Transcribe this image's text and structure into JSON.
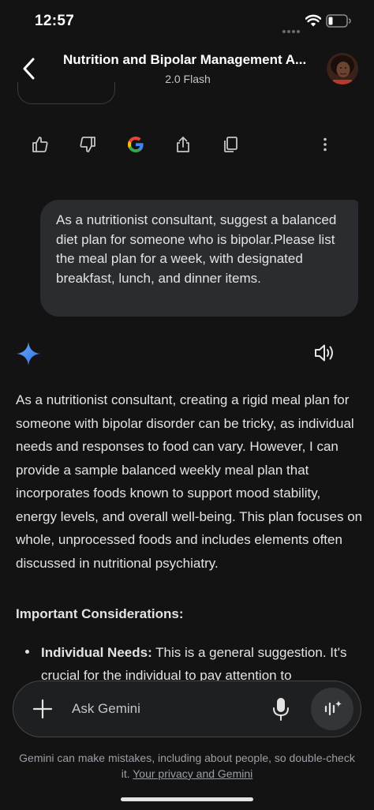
{
  "status_bar": {
    "time": "12:57"
  },
  "header": {
    "title": "Nutrition and Bipolar Management A...",
    "model": "2.0 Flash"
  },
  "user_message": {
    "text": "As a nutritionist consultant, suggest a balanced diet plan for someone who is bipolar.Please list the meal plan for a week, with designated breakfast, lunch, and dinner items."
  },
  "response": {
    "paragraph": "As a nutritionist consultant, creating a rigid meal plan for someone with bipolar disorder can be tricky, as individual needs and responses to food can vary. However, I can provide a sample balanced weekly meal plan that incorporates foods known to support mood stability, energy levels, and overall well-being. This plan focuses on whole, unprocessed foods and includes elements often discussed in nutritional psychiatry.",
    "considerations_heading": "Important Considerations:",
    "bullets": [
      {
        "bold": "Individual Needs:",
        "text": " This is a general suggestion. It's crucial for the individual to pay attention to"
      }
    ]
  },
  "input": {
    "placeholder": "Ask Gemini"
  },
  "disclaimer": {
    "text": "Gemini can make mistakes, including about people, so double-check it. ",
    "link": "Your privacy and Gemini"
  },
  "icons": {
    "action_row": [
      "thumbs-up-icon",
      "thumbs-down-icon",
      "google-g-icon",
      "share-icon",
      "copy-icon",
      "more-vertical-icon"
    ]
  },
  "colors": {
    "background": "#131314",
    "bubble": "#2b2c2f",
    "text": "#e3e3e3",
    "star_gradient_start": "#4e8cf6",
    "star_gradient_end": "#2b6fe0",
    "google_blue": "#4285f4",
    "google_red": "#ea4335",
    "google_yellow": "#fbbc05",
    "google_green": "#34a853"
  }
}
